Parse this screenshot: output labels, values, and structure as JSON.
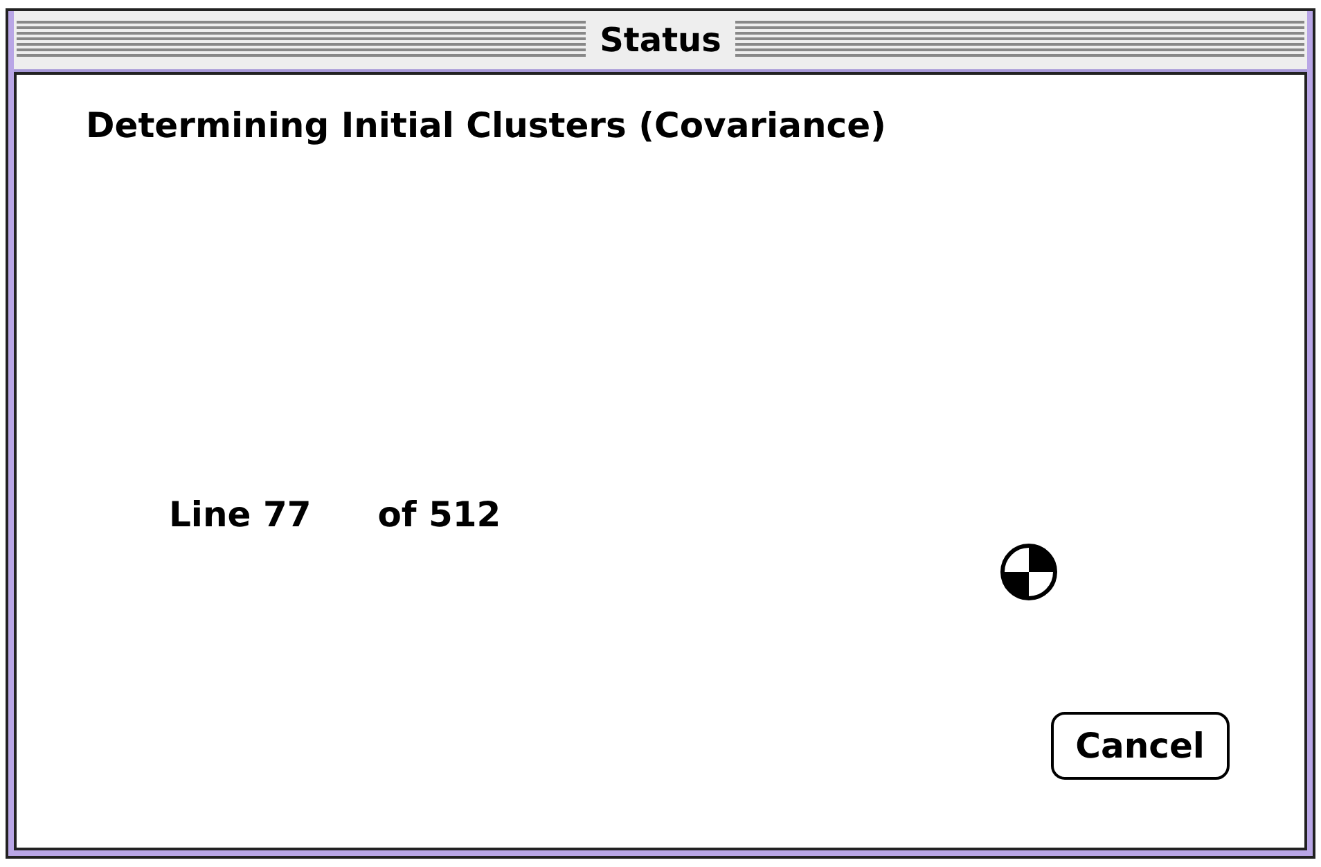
{
  "window": {
    "title": "Status"
  },
  "message": "Determining Initial Clusters (Covariance)",
  "progress": {
    "line_label": "Line 77",
    "total_label": "of 512"
  },
  "buttons": [
    "Cancel"
  ]
}
